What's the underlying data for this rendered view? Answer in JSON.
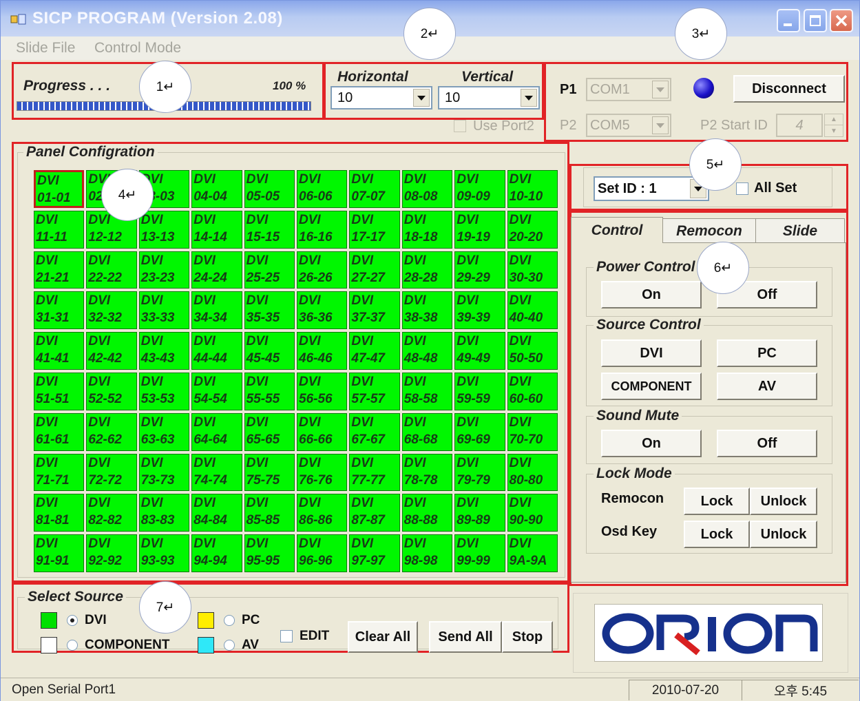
{
  "window": {
    "title": "SICP PROGRAM (Version 2.08)"
  },
  "menu": [
    "Slide File",
    "Control Mode"
  ],
  "progress": {
    "label": "Progress . . .",
    "percent_text": "100 %",
    "value": 1.0
  },
  "grid_size": {
    "horizontal_label": "Horizontal",
    "vertical_label": "Vertical",
    "horizontal_value": "10",
    "vertical_value": "10",
    "use_port2_label": "Use Port2"
  },
  "ports": {
    "p1_label": "P1",
    "p1_value": "COM1",
    "p2_label": "P2",
    "p2_value": "COM5",
    "disconnect_label": "Disconnect",
    "p2_start_label": "P2 Start ID",
    "p2_start_value": "4",
    "led_color": "#1a10c8"
  },
  "panel": {
    "title": "Panel Configration",
    "cells": [
      [
        "DVI",
        "01-01"
      ],
      [
        "DVI",
        "02-02"
      ],
      [
        "DVI",
        "03-03"
      ],
      [
        "DVI",
        "04-04"
      ],
      [
        "DVI",
        "05-05"
      ],
      [
        "DVI",
        "06-06"
      ],
      [
        "DVI",
        "07-07"
      ],
      [
        "DVI",
        "08-08"
      ],
      [
        "DVI",
        "09-09"
      ],
      [
        "DVI",
        "10-10"
      ],
      [
        "DVI",
        "11-11"
      ],
      [
        "DVI",
        "12-12"
      ],
      [
        "DVI",
        "13-13"
      ],
      [
        "DVI",
        "14-14"
      ],
      [
        "DVI",
        "15-15"
      ],
      [
        "DVI",
        "16-16"
      ],
      [
        "DVI",
        "17-17"
      ],
      [
        "DVI",
        "18-18"
      ],
      [
        "DVI",
        "19-19"
      ],
      [
        "DVI",
        "20-20"
      ],
      [
        "DVI",
        "21-21"
      ],
      [
        "DVI",
        "22-22"
      ],
      [
        "DVI",
        "23-23"
      ],
      [
        "DVI",
        "24-24"
      ],
      [
        "DVI",
        "25-25"
      ],
      [
        "DVI",
        "26-26"
      ],
      [
        "DVI",
        "27-27"
      ],
      [
        "DVI",
        "28-28"
      ],
      [
        "DVI",
        "29-29"
      ],
      [
        "DVI",
        "30-30"
      ],
      [
        "DVI",
        "31-31"
      ],
      [
        "DVI",
        "32-32"
      ],
      [
        "DVI",
        "33-33"
      ],
      [
        "DVI",
        "34-34"
      ],
      [
        "DVI",
        "35-35"
      ],
      [
        "DVI",
        "36-36"
      ],
      [
        "DVI",
        "37-37"
      ],
      [
        "DVI",
        "38-38"
      ],
      [
        "DVI",
        "39-39"
      ],
      [
        "DVI",
        "40-40"
      ],
      [
        "DVI",
        "41-41"
      ],
      [
        "DVI",
        "42-42"
      ],
      [
        "DVI",
        "43-43"
      ],
      [
        "DVI",
        "44-44"
      ],
      [
        "DVI",
        "45-45"
      ],
      [
        "DVI",
        "46-46"
      ],
      [
        "DVI",
        "47-47"
      ],
      [
        "DVI",
        "48-48"
      ],
      [
        "DVI",
        "49-49"
      ],
      [
        "DVI",
        "50-50"
      ],
      [
        "DVI",
        "51-51"
      ],
      [
        "DVI",
        "52-52"
      ],
      [
        "DVI",
        "53-53"
      ],
      [
        "DVI",
        "54-54"
      ],
      [
        "DVI",
        "55-55"
      ],
      [
        "DVI",
        "56-56"
      ],
      [
        "DVI",
        "57-57"
      ],
      [
        "DVI",
        "58-58"
      ],
      [
        "DVI",
        "59-59"
      ],
      [
        "DVI",
        "60-60"
      ],
      [
        "DVI",
        "61-61"
      ],
      [
        "DVI",
        "62-62"
      ],
      [
        "DVI",
        "63-63"
      ],
      [
        "DVI",
        "64-64"
      ],
      [
        "DVI",
        "65-65"
      ],
      [
        "DVI",
        "66-66"
      ],
      [
        "DVI",
        "67-67"
      ],
      [
        "DVI",
        "68-68"
      ],
      [
        "DVI",
        "69-69"
      ],
      [
        "DVI",
        "70-70"
      ],
      [
        "DVI",
        "71-71"
      ],
      [
        "DVI",
        "72-72"
      ],
      [
        "DVI",
        "73-73"
      ],
      [
        "DVI",
        "74-74"
      ],
      [
        "DVI",
        "75-75"
      ],
      [
        "DVI",
        "76-76"
      ],
      [
        "DVI",
        "77-77"
      ],
      [
        "DVI",
        "78-78"
      ],
      [
        "DVI",
        "79-79"
      ],
      [
        "DVI",
        "80-80"
      ],
      [
        "DVI",
        "81-81"
      ],
      [
        "DVI",
        "82-82"
      ],
      [
        "DVI",
        "83-83"
      ],
      [
        "DVI",
        "84-84"
      ],
      [
        "DVI",
        "85-85"
      ],
      [
        "DVI",
        "86-86"
      ],
      [
        "DVI",
        "87-87"
      ],
      [
        "DVI",
        "88-88"
      ],
      [
        "DVI",
        "89-89"
      ],
      [
        "DVI",
        "90-90"
      ],
      [
        "DVI",
        "91-91"
      ],
      [
        "DVI",
        "92-92"
      ],
      [
        "DVI",
        "93-93"
      ],
      [
        "DVI",
        "94-94"
      ],
      [
        "DVI",
        "95-95"
      ],
      [
        "DVI",
        "96-96"
      ],
      [
        "DVI",
        "97-97"
      ],
      [
        "DVI",
        "98-98"
      ],
      [
        "DVI",
        "99-99"
      ],
      [
        "DVI",
        "9A-9A"
      ]
    ],
    "cell_color": "#00f700",
    "selected_border": "#c0201c"
  },
  "setid": {
    "value": "Set ID : 1",
    "all_set_label": "All Set"
  },
  "tabs": [
    "Control",
    "Remocon",
    "Slide"
  ],
  "control": {
    "power": {
      "title": "Power Control",
      "on": "On",
      "off": "Off"
    },
    "source": {
      "title": "Source Control",
      "dvi": "DVI",
      "pc": "PC",
      "component": "COMPONENT",
      "av": "AV"
    },
    "mute": {
      "title": "Sound Mute",
      "on": "On",
      "off": "Off"
    },
    "lock": {
      "title": "Lock Mode",
      "remocon_label": "Remocon",
      "osd_label": "Osd Key",
      "lock": "Lock",
      "unlock": "Unlock"
    }
  },
  "select_source": {
    "title": "Select Source",
    "dvi": "DVI",
    "component": "COMPONENT",
    "pc": "PC",
    "av": "AV",
    "edit": "EDIT",
    "clear_all": "Clear All",
    "send_all": "Send All",
    "stop": "Stop",
    "colors": {
      "dvi": "#00e000",
      "component": "#ffffff",
      "pc": "#ffee00",
      "av": "#2fe8f8"
    }
  },
  "logo_text": "ORION",
  "callouts": [
    "1↵",
    "2↵",
    "3↵",
    "4↵",
    "5↵",
    "6↵",
    "7↵"
  ],
  "status": {
    "message": "Open Serial Port1",
    "date": "2010-07-20",
    "time": "오후 5:45"
  }
}
